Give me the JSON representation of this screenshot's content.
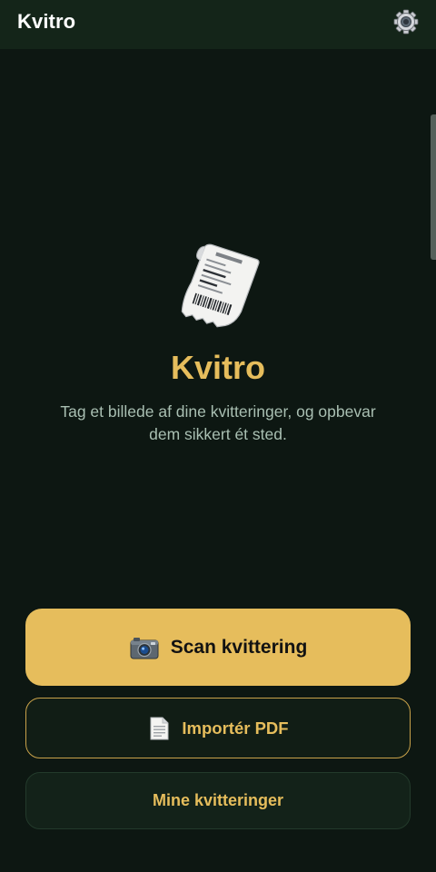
{
  "app": {
    "title": "Kvitro",
    "settings_icon": "gear-icon"
  },
  "hero": {
    "icon": "receipt-icon",
    "title": "Kvitro",
    "subtitle": "Tag et billede af dine kvitteringer, og opbevar dem sikkert ét sted."
  },
  "actions": {
    "scan": {
      "icon": "camera-icon",
      "label": "Scan kvittering"
    },
    "import": {
      "icon": "document-icon",
      "label": "Importér PDF"
    },
    "receipts": {
      "label": "Mine kvitteringer"
    }
  },
  "colors": {
    "background": "#0d1712",
    "topbar": "#142519",
    "accent": "#e6bd5c",
    "subtitle": "#a9bfb2"
  }
}
